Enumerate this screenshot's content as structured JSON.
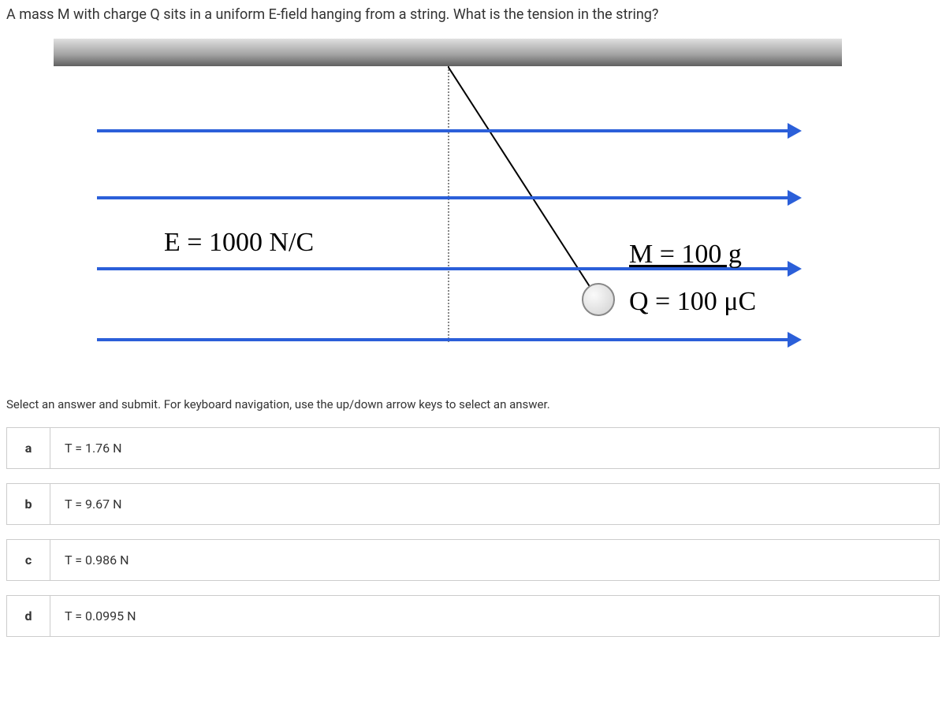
{
  "question": "A mass M with charge Q sits in a uniform E-field hanging from a string. What is the tension in the string?",
  "diagram": {
    "e_label": "E = 1000 N/C",
    "m_label": "M = 100 g",
    "q_label": "Q = 100 μC"
  },
  "instruction": "Select an answer and submit. For keyboard navigation, use the up/down arrow keys to select an answer.",
  "answers": [
    {
      "letter": "a",
      "text": "T = 1.76 N"
    },
    {
      "letter": "b",
      "text": "T = 9.67 N"
    },
    {
      "letter": "c",
      "text": "T = 0.986 N"
    },
    {
      "letter": "d",
      "text": "T = 0.0995 N"
    }
  ]
}
